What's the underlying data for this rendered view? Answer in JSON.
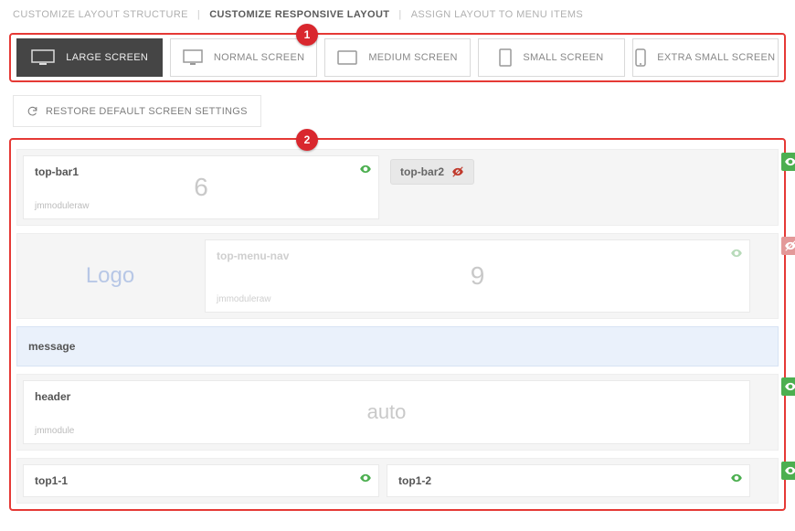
{
  "nav": [
    {
      "label": "CUSTOMIZE LAYOUT STRUCTURE",
      "active": false
    },
    {
      "label": "CUSTOMIZE RESPONSIVE LAYOUT",
      "active": true
    },
    {
      "label": "ASSIGN LAYOUT TO MENU ITEMS",
      "active": false
    }
  ],
  "callouts": {
    "screens": "1",
    "canvas": "2"
  },
  "screens": [
    {
      "label": "LARGE SCREEN",
      "icon": "monitor-wide",
      "active": true
    },
    {
      "label": "NORMAL SCREEN",
      "icon": "monitor",
      "active": false
    },
    {
      "label": "MEDIUM SCREEN",
      "icon": "tablet-land",
      "active": false
    },
    {
      "label": "SMALL SCREEN",
      "icon": "tablet-port",
      "active": false
    },
    {
      "label": "EXTRA SMALL SCREEN",
      "icon": "phone",
      "active": false
    }
  ],
  "restore_label": "RESTORE DEFAULT SCREEN SETTINGS",
  "rows": {
    "topbar1": {
      "name": "top-bar1",
      "width": "6",
      "module": "jmmoduleraw",
      "visible": true
    },
    "topbar2": {
      "name": "top-bar2",
      "visible": false
    },
    "logo": {
      "name": "Logo"
    },
    "topmenu": {
      "name": "top-menu-nav",
      "width": "9",
      "module": "jmmoduleraw",
      "visible": true,
      "row_hidden": true
    },
    "message": {
      "name": "message"
    },
    "header": {
      "name": "header",
      "width": "auto",
      "module": "jmmodule",
      "visible": true
    },
    "top11": {
      "name": "top1-1",
      "visible": true
    },
    "top12": {
      "name": "top1-2",
      "visible": true
    }
  }
}
